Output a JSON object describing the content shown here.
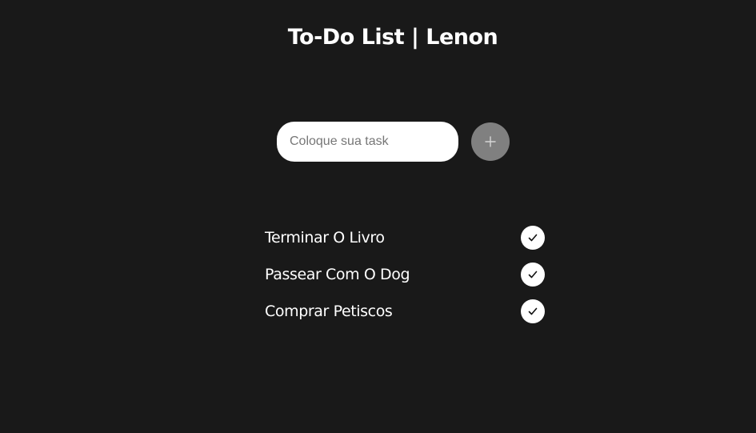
{
  "header": {
    "title": "To-Do List | Lenon"
  },
  "form": {
    "input_placeholder": "Coloque sua task",
    "input_value": "",
    "add_button_icon": "plus-icon",
    "add_button_color": "#808080"
  },
  "tasks": [
    {
      "label": "Terminar O Livro",
      "icon": "check-icon"
    },
    {
      "label": "Passear Com O Dog",
      "icon": "check-icon"
    },
    {
      "label": "Comprar Petiscos",
      "icon": "check-icon"
    }
  ],
  "colors": {
    "background": "#191919",
    "text": "#ffffff",
    "input_background": "#ffffff",
    "check_button_background": "#ffffff"
  }
}
